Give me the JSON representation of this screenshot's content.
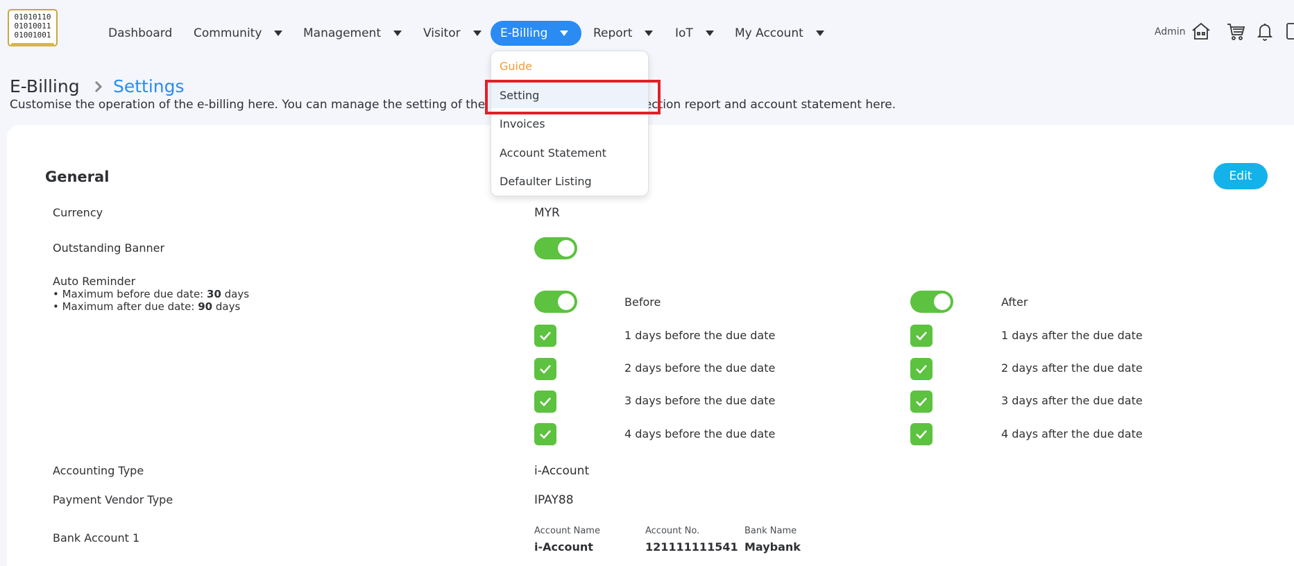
{
  "nav": {
    "items": [
      {
        "label": "Dashboard"
      },
      {
        "label": "Community"
      },
      {
        "label": "Management"
      },
      {
        "label": "Visitor"
      },
      {
        "label": "E-Billing"
      },
      {
        "label": "Report"
      },
      {
        "label": "IoT"
      },
      {
        "label": "My Account"
      }
    ],
    "active": "E-Billing",
    "admin_label": "Admin",
    "logo_lines": [
      "01010110",
      "01010011",
      "01001001"
    ]
  },
  "dropdown": {
    "items": [
      {
        "label": "Guide"
      },
      {
        "label": "Setting"
      },
      {
        "label": "Invoices"
      },
      {
        "label": "Account Statement"
      },
      {
        "label": "Defaulter Listing"
      }
    ]
  },
  "header": {
    "breadcrumb_root": "E-Billing",
    "breadcrumb_current": "Settings",
    "description": "Customise the operation of the e-billing here. You can manage the setting of the",
    "description_tail": "s, collection report and account statement here."
  },
  "general": {
    "title": "General",
    "edit_label": "Edit",
    "currency_label": "Currency",
    "currency_value": "MYR",
    "outstanding_label": "Outstanding Banner",
    "outstanding_on": true,
    "auto_reminder": {
      "label": "Auto Reminder",
      "max_before_prefix": "• Maximum before due date: ",
      "max_before_value": "30",
      "max_after_prefix": "• Maximum after due date: ",
      "max_after_value": "90",
      "days_suffix": " days",
      "before_label": "Before",
      "after_label": "After",
      "before_on": true,
      "after_on": true,
      "before_items": [
        "1 days before the due date",
        "2 days before the due date",
        "3 days before the due date",
        "4 days before the due date"
      ],
      "after_items": [
        "1 days after the due date",
        "2 days after the due date",
        "3 days after the due date",
        "4 days after the due date"
      ]
    },
    "accounting_type_label": "Accounting Type",
    "accounting_type_value": "i-Account",
    "payment_vendor_label": "Payment Vendor Type",
    "payment_vendor_value": "IPAY88",
    "bank_account": {
      "label": "Bank Account 1",
      "account_name_header": "Account Name",
      "account_name": "i-Account",
      "account_no_header": "Account No.",
      "account_no": "121111111541",
      "bank_name_header": "Bank Name",
      "bank_name": "Maybank"
    }
  },
  "colors": {
    "accent": "#2a8bf2",
    "toggle_green": "#5cc23f",
    "edit_button": "#14b2ea",
    "guide_orange": "#f29b3a",
    "highlight_red": "#e0202a"
  }
}
